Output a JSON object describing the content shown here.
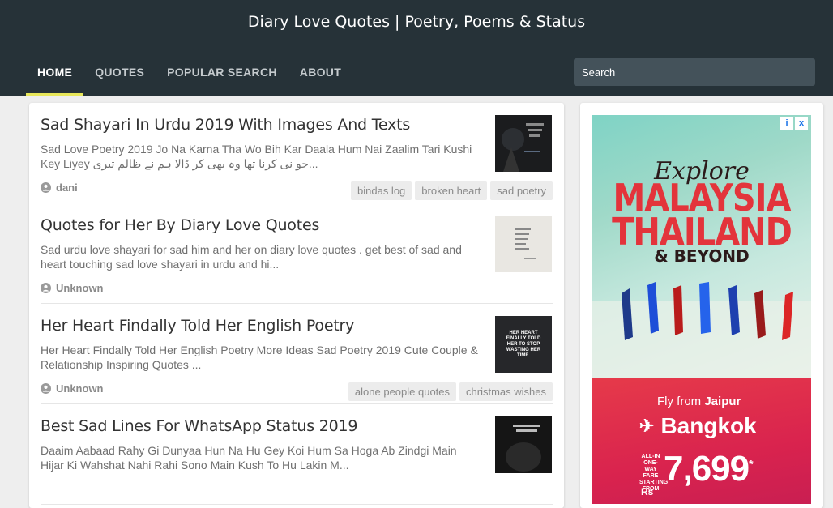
{
  "header": {
    "site_title": "Diary Love Quotes | Poetry, Poems & Status",
    "nav": [
      {
        "label": "HOME",
        "active": true
      },
      {
        "label": "QUOTES",
        "active": false
      },
      {
        "label": "POPULAR SEARCH",
        "active": false
      },
      {
        "label": "ABOUT",
        "active": false
      }
    ],
    "search_placeholder": "Search"
  },
  "posts": [
    {
      "title": "Sad Shayari In Urdu 2019 With Images And Texts",
      "snippet": "Sad Love Poetry 2019 Jo Na Karna Tha Wo Bih Kar Daala Hum Nai Zaalim Tari Kushi Key Liyey جو نی کرنا تھا وہ بھی کر ڈالا ہم نے ظالم تیری...",
      "author": "dani",
      "tags": [
        "bindas log",
        "broken heart",
        "sad poetry"
      ],
      "thumb_style": "dark-night"
    },
    {
      "title": "Quotes for Her By Diary Love Quotes",
      "snippet": "Sad urdu love shayari for sad him and her on  diary love quotes . get best of sad and heart touching sad love shayari in urdu and hi...",
      "author": "Unknown",
      "tags": [],
      "thumb_style": "paper-note"
    },
    {
      "title": "Her Heart Findally Told Her English Poetry",
      "snippet": "Her Heart Findally Told Her English Poetry More Ideas Sad Poetry 2019        Cute Couple & Relationship        Inspiring Quotes ...",
      "author": "Unknown",
      "tags": [
        "alone people quotes",
        "christmas wishes"
      ],
      "thumb_style": "dark-text",
      "thumb_text": "HER HEART FINALLY TOLD HER TO STOP WASTING HER TIME."
    },
    {
      "title": "Best Sad Lines For WhatsApp Status 2019",
      "snippet": "Daaim Aabaad Rahy Gi Dunyaa Hun Na Hu Gey Koi Hum Sa Hoga  Ab Zindgi Main Hijar Ki Wahshat Nahi Rahi  Sono Main Kush To Hu Lakin M...",
      "author": "",
      "tags": [],
      "thumb_style": "dark-night"
    }
  ],
  "ad": {
    "explore": "Explore",
    "country1": "MALAYSIA",
    "country2": "THAILAND",
    "beyond": "& BEYOND",
    "fly_prefix": "Fly from ",
    "origin": "Jaipur",
    "destination": "Bangkok",
    "fare_label": "ALL-IN ONE-WAY FARE STARTING FROM",
    "currency": "Rs",
    "price": "7,699",
    "price_mark": "*",
    "badges": [
      "i",
      "x"
    ],
    "colors": {
      "sea": "#7fd3c5",
      "banner": "#d9234e",
      "headline": "#e3343b"
    }
  },
  "colors": {
    "header_bg": "#263238",
    "active_underline": "#e8e75a",
    "page_bg": "#eeeeee"
  }
}
